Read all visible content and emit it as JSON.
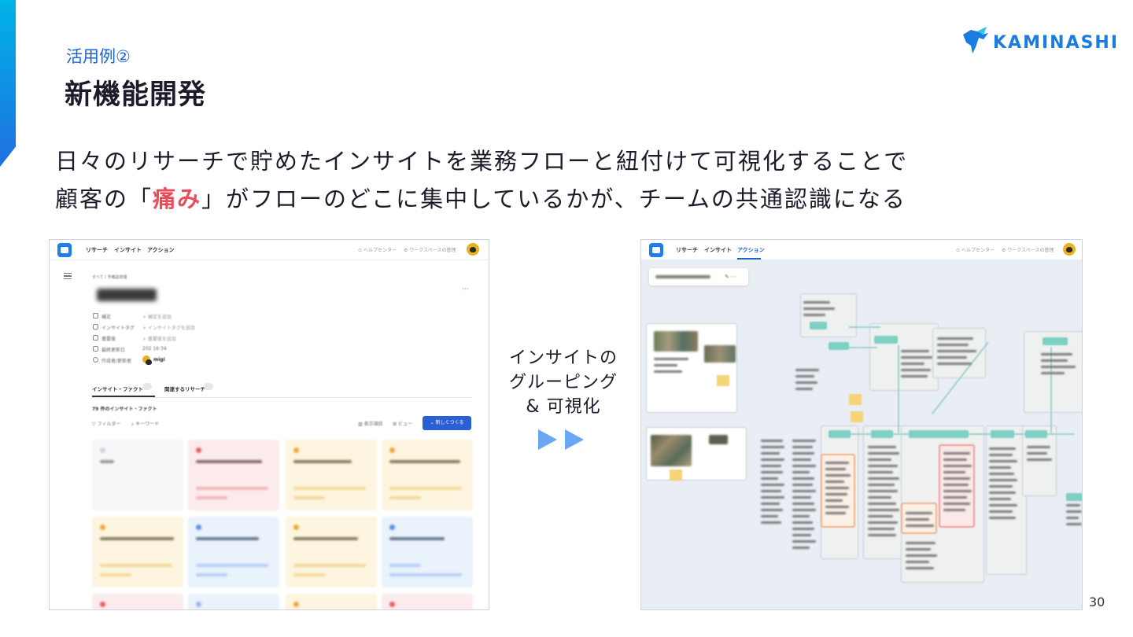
{
  "header": {
    "section_label": "活用例②",
    "title": "新機能開発",
    "brand": "KAMINASHI"
  },
  "lead": {
    "line1": "日々のリサーチで貯めたインサイトを業務フローと紐付けて可視化することで",
    "line2_before": "顧客の「",
    "line2_emphasis": "痛み",
    "line2_after": "」がフローのどこに集中しているかが、チームの共通認識になる"
  },
  "transition": {
    "line1": "インサイトの",
    "line2": "グルーピング",
    "line3": "& 可視化"
  },
  "left_screen": {
    "nav": [
      "リサーチ",
      "インサイト",
      "アクション"
    ],
    "help": "ヘルプセンター",
    "workspace": "ワークスペースの管理",
    "breadcrumb": "すべて / 予備品管理",
    "properties": [
      {
        "label": "補足",
        "value": "+ 補足を追加"
      },
      {
        "label": "インサイトタグ",
        "value": "+ インサイトタグを追加"
      },
      {
        "label": "重要度",
        "value": "+ 重要度を追加"
      },
      {
        "label": "最終更新日",
        "value": "202          16:34"
      },
      {
        "label": "作成者/更新者",
        "value": "migi"
      }
    ],
    "tabs": [
      "インサイト・ファクト",
      "関連するリサーチ"
    ],
    "count_text": "79 件のインサイト・ファクト",
    "filter": "フィルター",
    "keyword": "キーワード",
    "display_items": "表示項目",
    "view": "ビュー",
    "create_button": "新しくつくる"
  },
  "right_screen": {
    "nav": [
      "リサーチ",
      "インサイト",
      "アクション"
    ],
    "help": "ヘルプセンター",
    "workspace": "ワークスペースの管理"
  },
  "colors": {
    "accent_blue": "#1a64d6",
    "emphasis_red": "#e84d5a",
    "arrow_blue": "#6aa6f4"
  },
  "page_number": "30"
}
